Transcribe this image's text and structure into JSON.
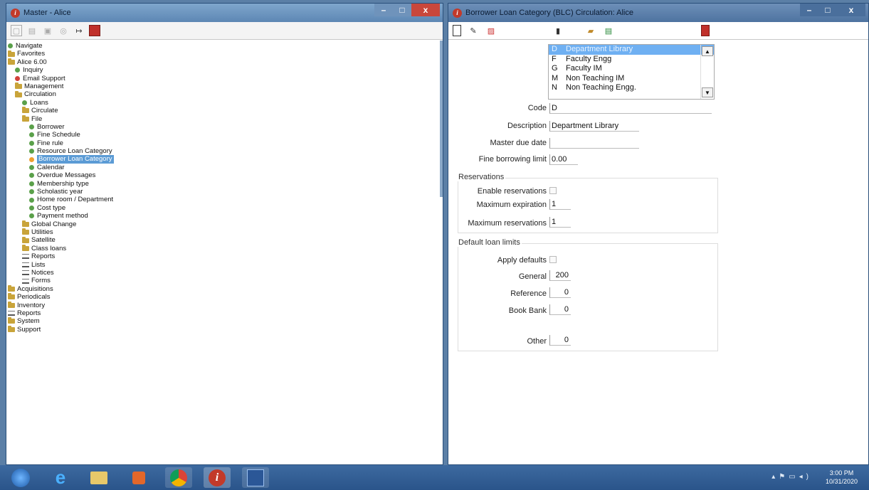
{
  "left_window": {
    "title": "Master - Alice",
    "tree": [
      {
        "label": "Navigate",
        "icon": "green-dot",
        "indent": 0
      },
      {
        "label": "Favorites",
        "icon": "folder",
        "indent": 0
      },
      {
        "label": "Alice 6.00",
        "icon": "folder",
        "indent": 0
      },
      {
        "label": "Inquiry",
        "icon": "green-dot",
        "indent": 1
      },
      {
        "label": "Email Support",
        "icon": "red-dot",
        "indent": 1
      },
      {
        "label": "Management",
        "icon": "folder",
        "indent": 1
      },
      {
        "label": "Circulation",
        "icon": "folder",
        "indent": 1
      },
      {
        "label": "Loans",
        "icon": "green-dot",
        "indent": 2
      },
      {
        "label": "Circulate",
        "icon": "folder",
        "indent": 2
      },
      {
        "label": "File",
        "icon": "folder",
        "indent": 2
      },
      {
        "label": "Borrower",
        "icon": "green-dot",
        "indent": 3
      },
      {
        "label": "Fine Schedule",
        "icon": "green-dot",
        "indent": 3
      },
      {
        "label": "Fine rule",
        "icon": "green-dot",
        "indent": 3
      },
      {
        "label": "Resource Loan Category",
        "icon": "green-dot",
        "indent": 3
      },
      {
        "label": "Borrower Loan Category",
        "icon": "orange-dot",
        "indent": 3,
        "selected": true
      },
      {
        "label": "Calendar",
        "icon": "green-dot",
        "indent": 3
      },
      {
        "label": "Overdue Messages",
        "icon": "green-dot",
        "indent": 3
      },
      {
        "label": "Membership type",
        "icon": "green-dot",
        "indent": 3
      },
      {
        "label": "Scholastic year",
        "icon": "green-dot",
        "indent": 3
      },
      {
        "label": "Home room / Department",
        "icon": "green-dot",
        "indent": 3
      },
      {
        "label": "Cost type",
        "icon": "green-dot",
        "indent": 3
      },
      {
        "label": "Payment method",
        "icon": "green-dot",
        "indent": 3
      },
      {
        "label": "Global Change",
        "icon": "folder",
        "indent": 2
      },
      {
        "label": "Utilities",
        "icon": "folder",
        "indent": 2
      },
      {
        "label": "Satellite",
        "icon": "folder",
        "indent": 2
      },
      {
        "label": "Class loans",
        "icon": "folder",
        "indent": 2
      },
      {
        "label": "Reports",
        "icon": "report",
        "indent": 2
      },
      {
        "label": "Lists",
        "icon": "report",
        "indent": 2
      },
      {
        "label": "Notices",
        "icon": "report",
        "indent": 2
      },
      {
        "label": "Forms",
        "icon": "report",
        "indent": 2
      },
      {
        "label": "Acquisitions",
        "icon": "folder",
        "indent": 0
      },
      {
        "label": "Periodicals",
        "icon": "folder",
        "indent": 0
      },
      {
        "label": "Inventory",
        "icon": "folder",
        "indent": 0
      },
      {
        "label": "Reports",
        "icon": "report",
        "indent": 0
      },
      {
        "label": "System",
        "icon": "folder",
        "indent": 0
      },
      {
        "label": "Support",
        "icon": "folder",
        "indent": 0
      }
    ]
  },
  "right_window": {
    "title": "Borrower Loan Category (BLC) Circulation: Alice",
    "list": [
      {
        "code": "D",
        "name": "Department Library",
        "selected": true
      },
      {
        "code": "F",
        "name": "Faculty Engg"
      },
      {
        "code": "G",
        "name": "Faculty IM"
      },
      {
        "code": "M",
        "name": "Non Teaching IM"
      },
      {
        "code": "N",
        "name": "Non Teaching Engg."
      }
    ],
    "fields": {
      "code_label": "Code",
      "code_value": "D",
      "description_label": "Description",
      "description_value": "Department Library",
      "master_due_date_label": "Master due date",
      "master_due_date_value": "",
      "fine_limit_label": "Fine borrowing limit",
      "fine_limit_value": "0.00"
    },
    "reservations": {
      "title": "Reservations",
      "enable_label": "Enable reservations",
      "max_expiration_label": "Maximum expiration",
      "max_expiration_value": "1",
      "max_reservations_label": "Maximum reservations",
      "max_reservations_value": "1"
    },
    "loan_limits": {
      "title": "Default loan limits",
      "apply_label": "Apply defaults",
      "general_label": "General",
      "general_value": "200",
      "reference_label": "Reference",
      "reference_value": "0",
      "bookbank_label": "Book Bank",
      "bookbank_value": "0",
      "other_label": "Other",
      "other_value": "0"
    }
  },
  "taskbar": {
    "time": "3:00 PM",
    "date": "10/31/2020"
  },
  "colors": {
    "title_bar": "#6c93bd",
    "selection": "#5b9bd5",
    "taskbar": "#2f5b92"
  }
}
